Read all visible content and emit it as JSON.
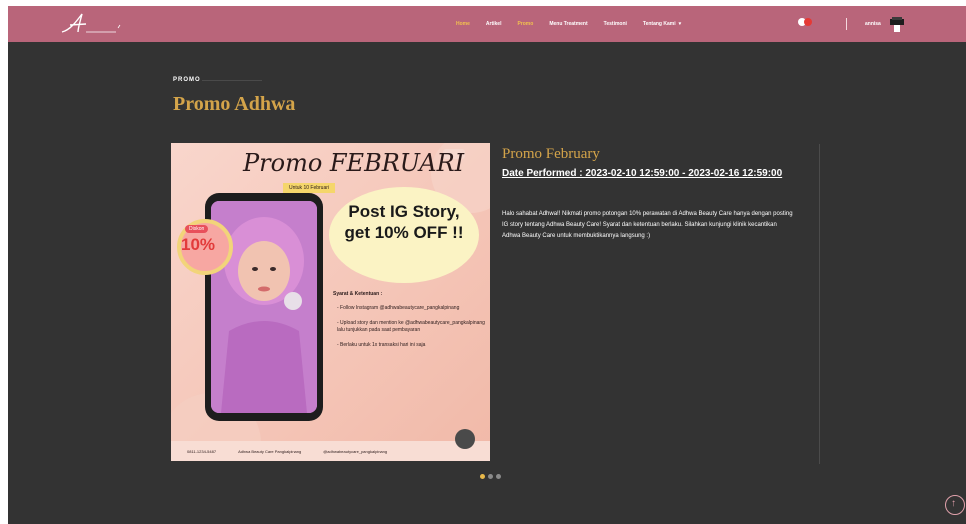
{
  "brand": {
    "logo_text": "A"
  },
  "nav": {
    "items": [
      {
        "label": "Home",
        "active": true
      },
      {
        "label": "Artikel",
        "active": false
      },
      {
        "label": "Promo",
        "active": false,
        "highlight": true
      },
      {
        "label": "Menu Treatment",
        "active": false
      },
      {
        "label": "Testimoni",
        "active": false
      },
      {
        "label": "Tentang Kami",
        "active": false,
        "dropdown": true
      }
    ],
    "user_name": "annisa",
    "cart_icon": "cart-icon"
  },
  "section": {
    "kicker": "PROMO",
    "title": "Promo Adhwa"
  },
  "poster": {
    "heading": "Promo FEBRUARI",
    "subheading": "Untuk 10 Februari",
    "badge_label": "Diskon",
    "badge_value": "10%",
    "bubble_text": "Post IG Story, get 10% OFF !!",
    "terms_title": "Syarat & Ketentuan :",
    "terms": [
      "- Follow Instagram @adhwabeautycare_pangkalpinang",
      "- Upload story dan mention ke @adhwabeautycare_pangkalpinang lalu tunjukkan pada saat pembayaran",
      "- Berlaku untuk 1x transaksi hari ini saja"
    ],
    "bottom_items": [
      "0811-1234-5487",
      "Adhwa Beauty Care Pangkalpinang",
      "@adhwabeautycare_pangkalpinang"
    ]
  },
  "promo": {
    "title": "Promo February",
    "date": "Date Performed : 2023-02-10 12:59:00 - 2023-02-16 12:59:00",
    "description": "Halo sahabat Adhwa!! Nikmati promo potongan 10% perawatan di Adhwa Beauty Care hanya dengan posting IG story tentang Adhwa Beauty Care! Syarat dan ketentuan berlaku. Silahkan kunjungi klinik kecantikan Adhwa Beauty Care untuk membuktikannya langsung :)"
  },
  "carousel": {
    "count": 3,
    "active_index": 0
  },
  "colors": {
    "navbar": "#b9657a",
    "accent": "#d4a44a",
    "background": "#333333"
  }
}
